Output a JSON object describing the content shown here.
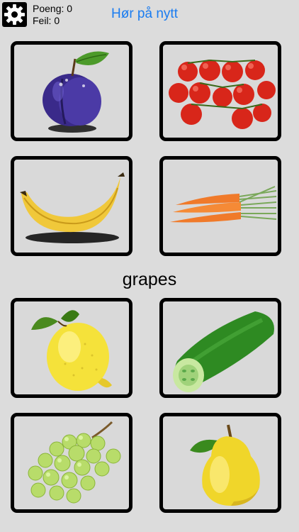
{
  "header": {
    "score_label": "Poeng: 0",
    "error_label": "Feil: 0",
    "replay_label": "Hør på nytt",
    "settings_icon": "gear-icon"
  },
  "prompt_word": "grapes",
  "cards_top": [
    {
      "fruit": "plum"
    },
    {
      "fruit": "tomatoes"
    },
    {
      "fruit": "banana"
    },
    {
      "fruit": "carrots"
    }
  ],
  "cards_bottom": [
    {
      "fruit": "lemon"
    },
    {
      "fruit": "cucumber"
    },
    {
      "fruit": "grapes"
    },
    {
      "fruit": "pear"
    }
  ],
  "colors": {
    "background": "#dcdcdc",
    "card_background": "#d9d9d9",
    "card_border": "#000000",
    "accent": "#1a7cf0"
  }
}
